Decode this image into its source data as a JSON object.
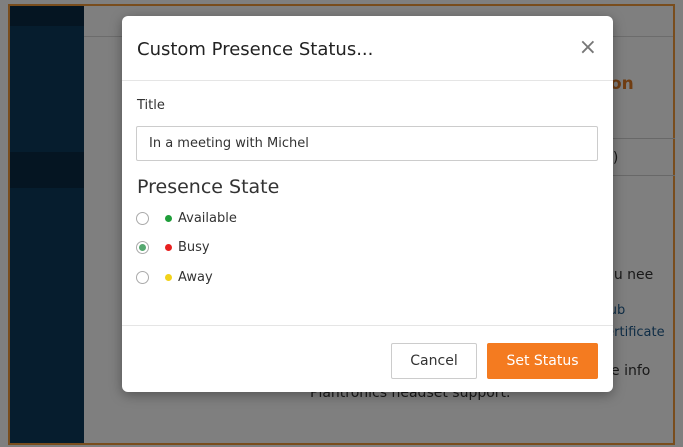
{
  "background": {
    "heading_fragment": "tion",
    "box_text_fragment": "d)",
    "text_fragment_1": "you nee",
    "link_fragment_1": "Hub",
    "link_fragment_2": "certificate",
    "text_fragment_2": "ore info",
    "text_fragment_3": "Plantronics headset support.",
    "accent_color": "#f39a3a",
    "sidebar_color": "#0d3a5c"
  },
  "modal": {
    "title": "Custom Presence Status...",
    "close_glyph": "×",
    "title_field": {
      "label": "Title",
      "value": "In a meeting with Michel"
    },
    "presence_section": {
      "heading": "Presence State",
      "options": [
        {
          "label": "Available",
          "color": "#1f9e3a",
          "selected": false
        },
        {
          "label": "Busy",
          "color": "#e8201f",
          "selected": true
        },
        {
          "label": "Away",
          "color": "#f2d21a",
          "selected": false
        }
      ]
    },
    "buttons": {
      "cancel_label": "Cancel",
      "set_status_label": "Set Status",
      "primary_color": "#f47b20"
    }
  }
}
